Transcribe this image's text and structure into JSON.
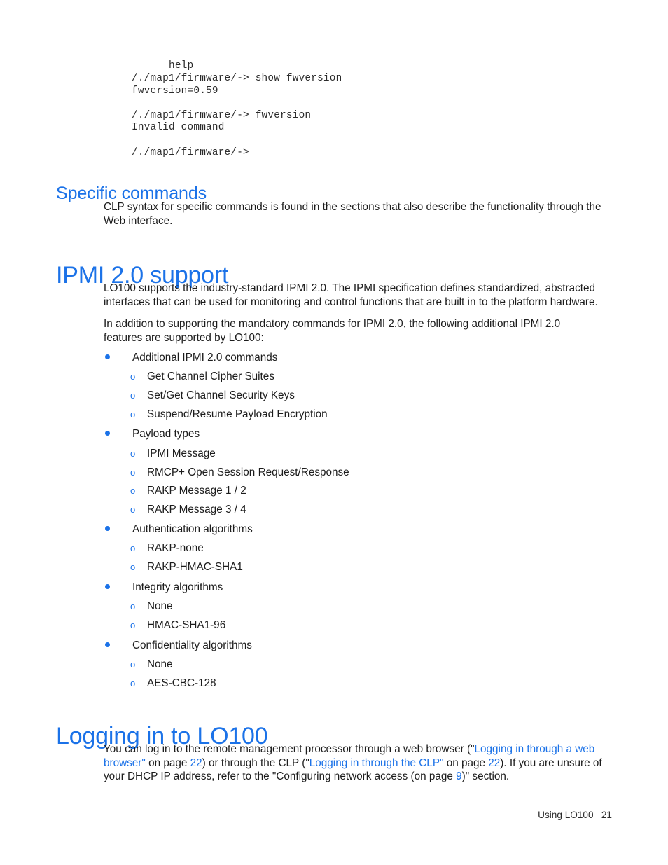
{
  "page": {
    "footer_label": "Using LO100",
    "footer_page_number": "21"
  },
  "code_block": {
    "lines": [
      "      help",
      "/./map1/firmware/-> show fwversion",
      "fwversion=0.59",
      "",
      "/./map1/firmware/-> fwversion",
      "Invalid command",
      "",
      "/./map1/firmware/->"
    ]
  },
  "sections": [
    {
      "id": "specific-commands",
      "heading": "Specific commands",
      "level": "h2",
      "paragraph_lines": [
        "CLP syntax for specific commands is found in the sections that also describe the functionality through the",
        "Web interface."
      ]
    },
    {
      "id": "ipmi-support",
      "heading": "IPMI 2.0 support",
      "level": "h1",
      "paragraph1_lines": [
        "LO100 supports the industry-standard IPMI 2.0. The IPMI specification defines standardized, abstracted",
        "interfaces that can be used for monitoring and control functions that are built in to the platform hardware."
      ],
      "paragraph2_lines": [
        "In addition to supporting the mandatory commands for IPMI 2.0, the following additional IPMI 2.0",
        "features are supported by LO100:"
      ]
    },
    {
      "id": "logging-in",
      "heading": "Logging in to LO100",
      "level": "h1"
    }
  ],
  "feature_list": [
    {
      "label": "Additional IPMI 2.0 commands",
      "children": [
        "Get Channel Cipher Suites",
        "Set/Get Channel Security Keys",
        "Suspend/Resume Payload Encryption"
      ]
    },
    {
      "label": "Payload types",
      "children": [
        "IPMI Message",
        "RMCP+ Open Session Request/Response",
        "RAKP Message 1 / 2",
        "RAKP Message 3 / 4"
      ]
    },
    {
      "label": "Authentication algorithms",
      "children": [
        "RAKP-none",
        "RAKP-HMAC-SHA1"
      ]
    },
    {
      "label": "Integrity algorithms",
      "children": [
        "None",
        "HMAC-SHA1-96"
      ]
    },
    {
      "label": "Confidentiality algorithms",
      "children": [
        "None",
        "AES-CBC-128"
      ]
    }
  ],
  "login_paragraph": {
    "line1_a": "You can log in to the remote management processor through a web browser (\"",
    "line1_link": "Logging in through a web",
    "line2_link_cont": "browser\"",
    "line2_b": " on page ",
    "line2_page1": "22",
    "line2_c": ") or through the CLP (\"",
    "line2_link2": "Logging in through the CLP\"",
    "line2_d": " on page ",
    "line2_page2": "22",
    "line2_e": "). If you are unsure of",
    "line3_a": "your DHCP IP address, refer to the \"Configuring network access (on page ",
    "line3_page3": "9",
    "line3_b": ")\" section."
  },
  "colors": {
    "heading_blue": "#1b72e8",
    "link_blue": "#1b72e8",
    "bullet_blue": "#1b72e8",
    "body_text": "#1c1c1c",
    "page_background": "#ffffff"
  }
}
